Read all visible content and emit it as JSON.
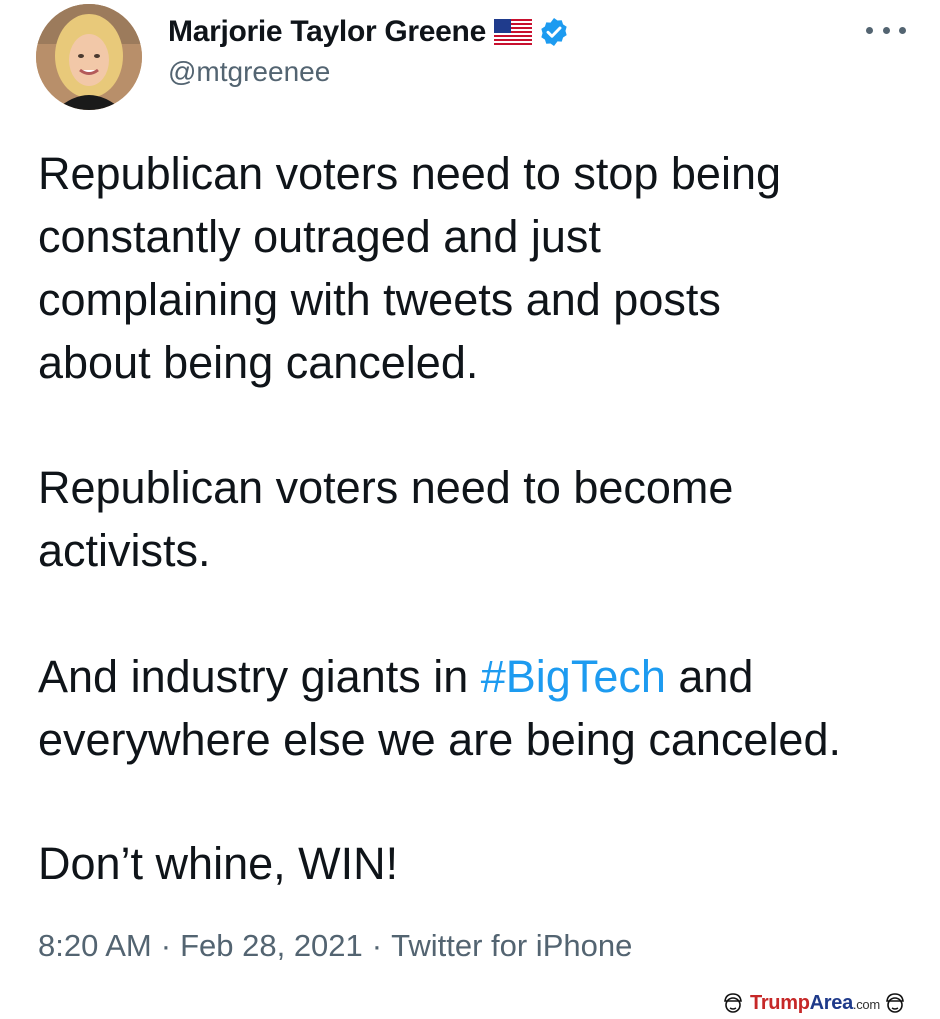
{
  "tweet": {
    "author": {
      "display_name": "Marjorie Taylor Greene",
      "handle": "@mtgreenee",
      "flag_icon": "us-flag-icon",
      "verified_icon": "verified-badge-icon",
      "verified_color": "#1d9bf0"
    },
    "more_icon": "more-horizontal-icon",
    "paragraphs": [
      {
        "lines": [
          "Republican voters need to stop being",
          "constantly outraged and just",
          "complaining with tweets and posts",
          "about being canceled."
        ]
      },
      {
        "lines": [
          "Republican voters need to become",
          "activists."
        ]
      },
      {
        "line1_before": "And industry giants in ",
        "hashtag": "#BigTech",
        "line1_after": " and",
        "line2": "everywhere else we are being canceled."
      },
      {
        "lines": [
          "Don’t whine, WIN!"
        ]
      }
    ],
    "meta": {
      "time": "8:20 AM",
      "date": "Feb 28, 2021",
      "source": "Twitter for iPhone",
      "separator": "·"
    },
    "colors": {
      "text": "#0f1419",
      "secondary": "#536471",
      "hashtag": "#1d9bf0"
    }
  },
  "watermark": {
    "part1": "Trump",
    "part2": "Area",
    "part3": ".com",
    "icon": "trump-face-icon"
  }
}
